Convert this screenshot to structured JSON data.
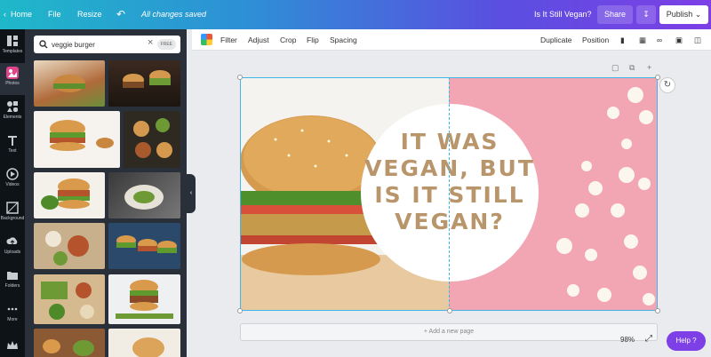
{
  "topbar": {
    "home": "Home",
    "file": "File",
    "resize": "Resize",
    "saved": "All changes saved",
    "title": "Is It Still Vegan?",
    "share": "Share",
    "publish": "Publish"
  },
  "rail": [
    {
      "label": "Templates",
      "icon": "templates-icon"
    },
    {
      "label": "Photos",
      "icon": "photos-icon"
    },
    {
      "label": "Elements",
      "icon": "elements-icon"
    },
    {
      "label": "Text",
      "icon": "text-icon"
    },
    {
      "label": "Videos",
      "icon": "videos-icon"
    },
    {
      "label": "Background",
      "icon": "background-icon"
    },
    {
      "label": "Uploads",
      "icon": "uploads-icon"
    },
    {
      "label": "Folders",
      "icon": "folders-icon"
    },
    {
      "label": "More",
      "icon": "more-icon"
    }
  ],
  "search": {
    "value": "veggie burger",
    "badge": "FREE"
  },
  "toolbar": {
    "filter": "Filter",
    "adjust": "Adjust",
    "crop": "Crop",
    "flip": "Flip",
    "spacing": "Spacing",
    "duplicate": "Duplicate",
    "position": "Position"
  },
  "canvas": {
    "headline": "IT WAS VEGAN, BUT IS IT STILL VEGAN?"
  },
  "footer": {
    "add_page": "+ Add a new page",
    "zoom": "98%",
    "help": "Help ?"
  },
  "colors": {
    "accent": "#7d3fe6",
    "pink": "#f2a5b3",
    "headline": "#b8956b",
    "selection": "#3fb6e8"
  }
}
